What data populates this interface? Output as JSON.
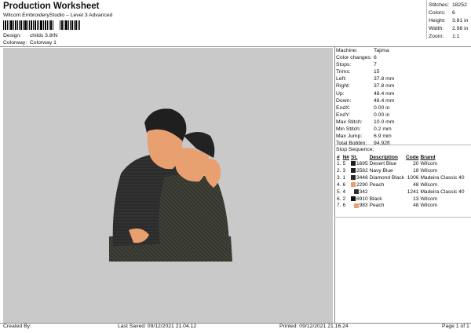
{
  "header": {
    "title": "Production Worksheet",
    "subtitle": "Wilcom EmbroideryStudio – Level 3 Advanced",
    "design_label": "Design:",
    "design_value": "childs 3.8IN",
    "colorway_label": "Colorway:",
    "colorway_value": "Colorway 1"
  },
  "stats": [
    {
      "label": "Stitches:",
      "value": "18252"
    },
    {
      "label": "Colors:",
      "value": "6"
    },
    {
      "label": "Height:",
      "value": "3.81 in"
    },
    {
      "label": "Width:",
      "value": "2.98 in"
    },
    {
      "label": "Zoom:",
      "value": "1:1"
    }
  ],
  "info": [
    {
      "label": "Machine:",
      "value": "Tajima"
    },
    {
      "label": "Color changes:",
      "value": "6"
    },
    {
      "label": "Stops:",
      "value": "7"
    },
    {
      "label": "Trims:",
      "value": "15"
    },
    {
      "label": "Left:",
      "value": "37.8 mm"
    },
    {
      "label": "Right:",
      "value": "37.8 mm"
    },
    {
      "label": "Up:",
      "value": "48.4 mm"
    },
    {
      "label": "Down:",
      "value": "48.4 mm"
    },
    {
      "label": "EndX:",
      "value": "0.00 in"
    },
    {
      "label": "EndY:",
      "value": "0.00 in"
    },
    {
      "label": "Max Stitch:",
      "value": "10.0 mm"
    },
    {
      "label": "Min Stitch:",
      "value": "0.2 mm"
    },
    {
      "label": "Max Jump:",
      "value": "6.9 mm"
    },
    {
      "label": "Total Bobbin:",
      "value": "94.92ft"
    }
  ],
  "sequence": {
    "title": "Stop Sequence:",
    "headers": [
      "#",
      "N#",
      "St.",
      "Description",
      "Code",
      "Brand"
    ],
    "rows": [
      {
        "stop": "1.",
        "n": "5",
        "color": "#1e1e1e",
        "st": "1695",
        "desc": "Desert Blue",
        "code": "20",
        "brand": "Wilcom"
      },
      {
        "stop": "2.",
        "n": "3",
        "color": "#1c1c22",
        "st": "2582",
        "desc": "Navy Blue",
        "code": "18",
        "brand": "Wilcom"
      },
      {
        "stop": "3.",
        "n": "1",
        "color": "#2a2a2a",
        "st": "3448",
        "desc": "Diamond Black",
        "code": "1006",
        "brand": "Madeira Classic 40"
      },
      {
        "stop": "4.",
        "n": "6",
        "color": "#e9a070",
        "st": "2290",
        "desc": "Peach",
        "code": "48",
        "brand": "Wilcom"
      },
      {
        "stop": "5.",
        "n": "4",
        "color": "#2e2e2e",
        "st": "342",
        "desc": "",
        "code": "1241",
        "brand": "Madeira Classic 40"
      },
      {
        "stop": "6.",
        "n": "2",
        "color": "#101010",
        "st": "6910",
        "desc": "Black",
        "code": "13",
        "brand": "Wilcom"
      },
      {
        "stop": "7.",
        "n": "6",
        "color": "#e9a070",
        "st": "983",
        "desc": "Peach",
        "code": "48",
        "brand": "Wilcom"
      }
    ]
  },
  "footer": {
    "created": "Created By:",
    "saved": "Last Saved: 09/12/2021 21.04.12",
    "printed": "Printed: 09/12/2021 21.16.24",
    "page": "Page 1 of 1"
  },
  "colors": {
    "canvas": "#c9c9c9",
    "peach": "#e9a070",
    "dark": "#2a2a2a"
  }
}
